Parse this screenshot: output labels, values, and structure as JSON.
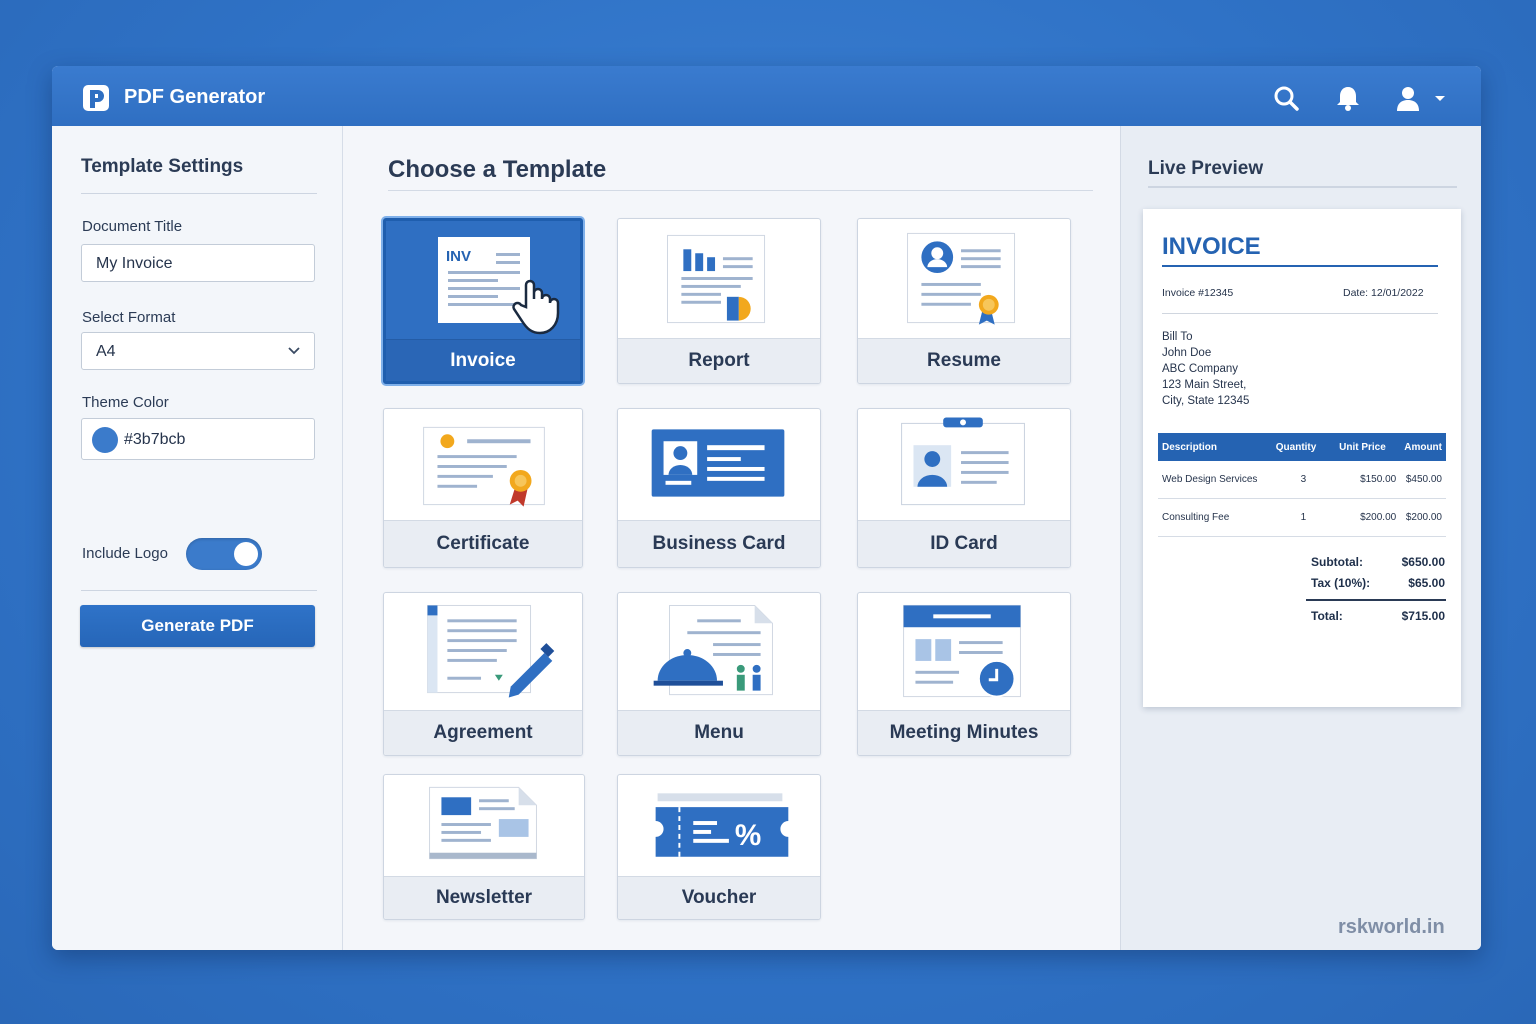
{
  "app": {
    "title": "PDF Generator"
  },
  "header_icons": [
    "search-icon",
    "bell-icon",
    "user-icon",
    "caret-down-icon"
  ],
  "settings": {
    "title": "Template Settings",
    "doc_title_label": "Document Title",
    "doc_title_value": "My Invoice",
    "format_label": "Select Format",
    "format_value": "A4",
    "theme_label": "Theme Color",
    "theme_value": "#3b7bcb",
    "logo_label": "Include Logo",
    "logo_enabled": true,
    "generate_label": "Generate PDF"
  },
  "templates": {
    "title": "Choose a Template",
    "selected": "Invoice",
    "items": [
      {
        "label": "Invoice",
        "icon": "invoice-doc-icon"
      },
      {
        "label": "Report",
        "icon": "report-doc-icon"
      },
      {
        "label": "Resume",
        "icon": "resume-doc-icon"
      },
      {
        "label": "Certificate",
        "icon": "certificate-doc-icon"
      },
      {
        "label": "Business Card",
        "icon": "business-card-icon"
      },
      {
        "label": "ID Card",
        "icon": "id-card-icon"
      },
      {
        "label": "Agreement",
        "icon": "agreement-doc-icon"
      },
      {
        "label": "Menu",
        "icon": "menu-doc-icon"
      },
      {
        "label": "Meeting Minutes",
        "icon": "meeting-minutes-icon"
      },
      {
        "label": "Newsletter",
        "icon": "newsletter-icon"
      },
      {
        "label": "Voucher",
        "icon": "voucher-icon"
      }
    ],
    "invoice_thumb_text": "INV"
  },
  "preview": {
    "title": "Live Preview",
    "invoice": {
      "heading": "INVOICE",
      "number": "Invoice #12345",
      "date": "Date: 12/01/2022",
      "bill_to": [
        "Bill To",
        "John Doe",
        "ABC Company",
        "123 Main Street,",
        "City, State 12345"
      ],
      "columns": [
        "Description",
        "Quantity",
        "Unit Price",
        "Amount"
      ],
      "rows": [
        [
          "Web Design Services",
          "3",
          "$150.00",
          "$450.00"
        ],
        [
          "Consulting Fee",
          "1",
          "$200.00",
          "$200.00"
        ]
      ],
      "subtotal_label": "Subtotal:",
      "subtotal_value": "$650.00",
      "tax_label": "Tax (10%):",
      "tax_value": "$65.00",
      "total_label": "Total:",
      "total_value": "$715.00"
    }
  },
  "watermark": "rskworld.in",
  "colors": {
    "accent": "#3b7bcb",
    "header": "#2f6fc2",
    "invoice_blue": "#2563b2",
    "award": "#f2a81d"
  }
}
